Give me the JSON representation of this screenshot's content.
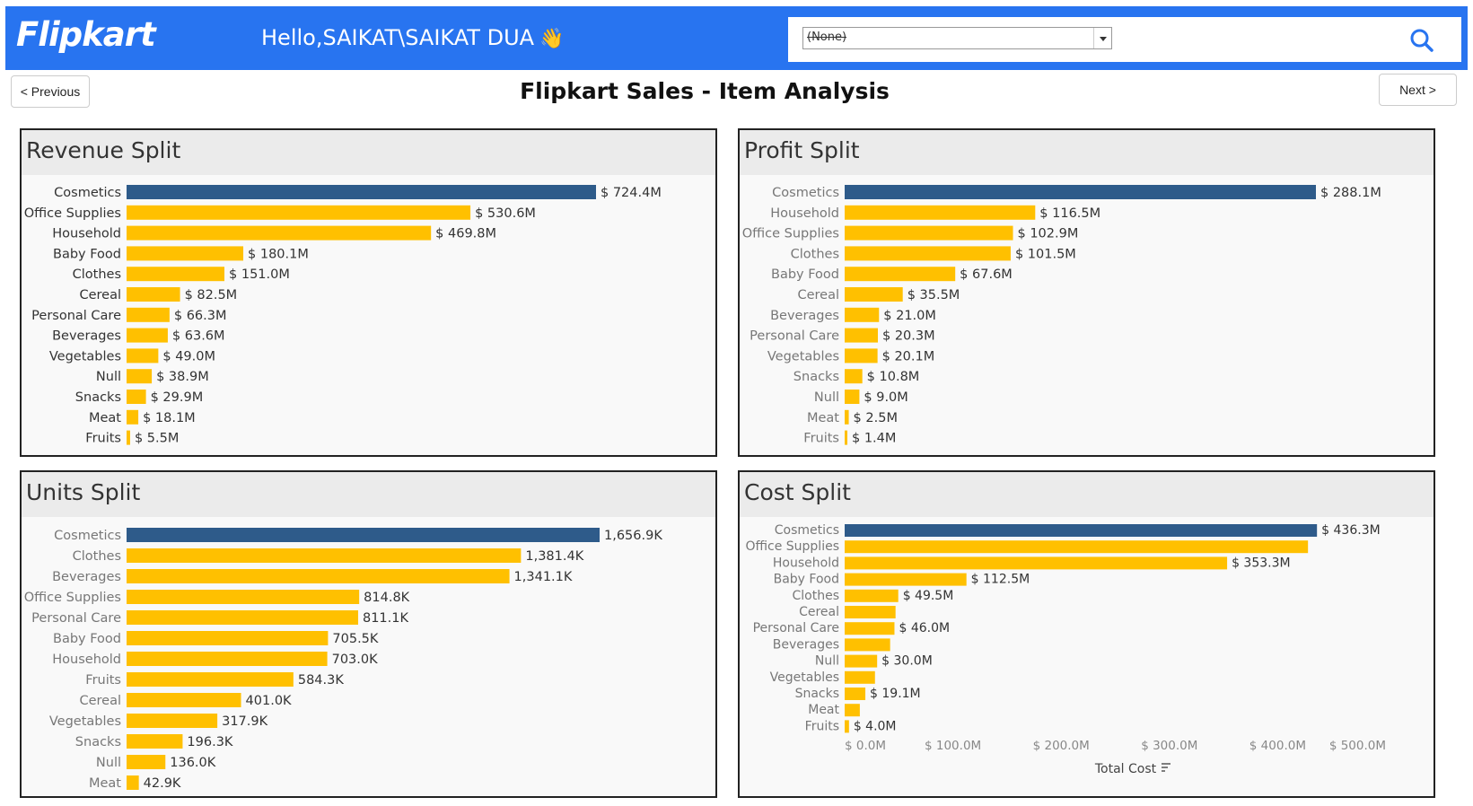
{
  "header": {
    "logo": "Flipkart",
    "greeting": "Hello,SAIKAT\\SAIKAT DUA",
    "filter_value": "(None)",
    "brand_color": "#2874f0"
  },
  "nav": {
    "previous_label": "< Previous",
    "next_label": "Next >"
  },
  "page_title": "Flipkart Sales - Item Analysis",
  "colors": {
    "highlight": "#2e5b8a",
    "bar": "#ffc000"
  },
  "chart_data": [
    {
      "type": "bar",
      "title": "Revenue Split",
      "orientation": "horizontal",
      "categories": [
        "Cosmetics",
        "Office Supplies",
        "Household",
        "Baby Food",
        "Clothes",
        "Cereal",
        "Personal Care",
        "Beverages",
        "Vegetables",
        "Null",
        "Snacks",
        "Meat",
        "Fruits"
      ],
      "values": [
        724.4,
        530.6,
        469.8,
        180.1,
        151.0,
        82.5,
        66.3,
        63.6,
        49.0,
        38.9,
        29.9,
        18.1,
        5.5
      ],
      "labels": [
        "$ 724.4M",
        "$ 530.6M",
        "$ 469.8M",
        "$ 180.1M",
        "$ 151.0M",
        "$ 82.5M",
        "$ 66.3M",
        "$ 63.6M",
        "$ 49.0M",
        "$ 38.9M",
        "$ 29.9M",
        "$ 18.1M",
        "$ 5.5M"
      ],
      "unit": "$M"
    },
    {
      "type": "bar",
      "title": "Profit Split",
      "orientation": "horizontal",
      "categories": [
        "Cosmetics",
        "Household",
        "Office Supplies",
        "Clothes",
        "Baby Food",
        "Cereal",
        "Beverages",
        "Personal Care",
        "Vegetables",
        "Snacks",
        "Null",
        "Meat",
        "Fruits"
      ],
      "values": [
        288.1,
        116.5,
        102.9,
        101.5,
        67.6,
        35.5,
        21.0,
        20.3,
        20.1,
        10.8,
        9.0,
        2.5,
        1.4
      ],
      "labels": [
        "$ 288.1M",
        "$ 116.5M",
        "$ 102.9M",
        "$ 101.5M",
        "$ 67.6M",
        "$ 35.5M",
        "$ 21.0M",
        "$ 20.3M",
        "$ 20.1M",
        "$ 10.8M",
        "$ 9.0M",
        "$ 2.5M",
        "$ 1.4M"
      ],
      "unit": "$M"
    },
    {
      "type": "bar",
      "title": "Units Split",
      "orientation": "horizontal",
      "categories": [
        "Cosmetics",
        "Clothes",
        "Beverages",
        "Office Supplies",
        "Personal Care",
        "Baby Food",
        "Household",
        "Fruits",
        "Cereal",
        "Vegetables",
        "Snacks",
        "Null",
        "Meat"
      ],
      "values": [
        1656.9,
        1381.4,
        1341.1,
        814.8,
        811.1,
        705.5,
        703.0,
        584.3,
        401.0,
        317.9,
        196.3,
        136.0,
        42.9
      ],
      "labels": [
        "1,656.9K",
        "1,381.4K",
        "1,341.1K",
        "814.8K",
        "811.1K",
        "705.5K",
        "703.0K",
        "584.3K",
        "401.0K",
        "317.9K",
        "196.3K",
        "136.0K",
        "42.9K"
      ],
      "unit": "K"
    },
    {
      "type": "bar",
      "title": "Cost Split",
      "orientation": "horizontal",
      "categories": [
        "Cosmetics",
        "Office Supplies",
        "Household",
        "Baby Food",
        "Clothes",
        "Cereal",
        "Personal Care",
        "Beverages",
        "Null",
        "Vegetables",
        "Snacks",
        "Meat",
        "Fruits"
      ],
      "values": [
        436.3,
        428,
        353.3,
        112.5,
        49.5,
        47,
        46.0,
        42,
        30.0,
        28,
        19.1,
        14,
        4.0
      ],
      "labels": [
        "$ 436.3M",
        "",
        "$ 353.3M",
        "$ 112.5M",
        "$ 49.5M",
        "",
        "$ 46.0M",
        "",
        "$ 30.0M",
        "",
        "$ 19.1M",
        "",
        "$ 4.0M"
      ],
      "xlabel": "Total Cost",
      "xlim": [
        0,
        500
      ],
      "xticks": [
        0,
        100,
        200,
        300,
        400,
        500
      ],
      "xtick_labels": [
        "$ 0.0M",
        "$ 100.0M",
        "$ 200.0M",
        "$ 300.0M",
        "$ 400.0M",
        "$ 500.0M"
      ],
      "unit": "$M"
    }
  ]
}
